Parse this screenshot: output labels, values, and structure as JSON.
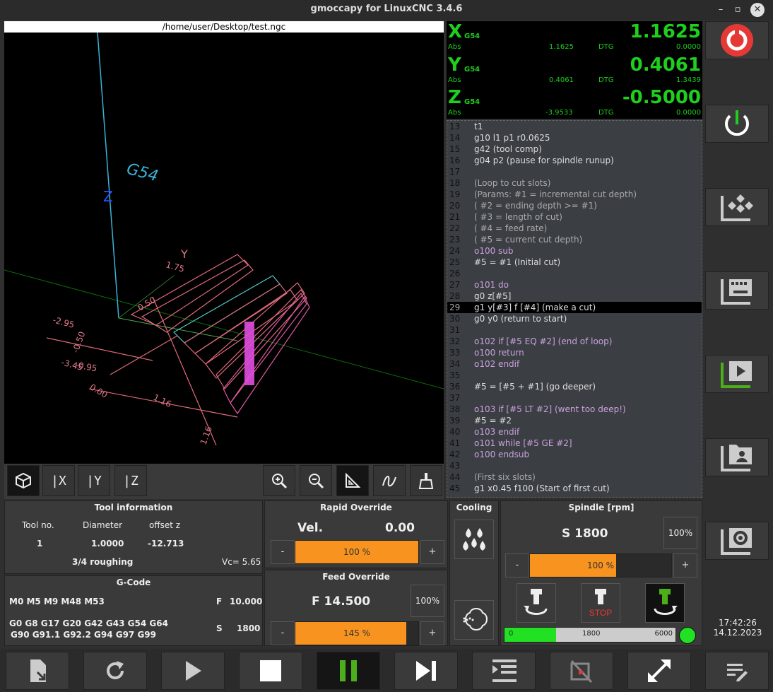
{
  "window": {
    "title": "gmoccapy for LinuxCNC  3.4.6"
  },
  "preview": {
    "filename": "/home/user/Desktop/test.ngc",
    "labels": {
      "coord": "G54",
      "zaxis": "Z",
      "yaxis": "Y",
      "d1": "-2.95",
      "d2": "-0.50",
      "d3": "-0.95",
      "d4": "-3.45",
      "d5": "0.00",
      "d6": "1.16",
      "d7": "1.16",
      "d8": "1.75",
      "d9": "0.50"
    }
  },
  "view_buttons": [
    "perspective-view",
    "x-view",
    "y-view",
    "z-view",
    "zoom-in",
    "zoom-out",
    "dimensions",
    "tool-path",
    "clear-plot"
  ],
  "dro": {
    "axes": [
      {
        "axis": "X",
        "cs": "G54",
        "value": "1.1625",
        "abs_label": "Abs",
        "abs": "1.1625",
        "dtg_label": "DTG",
        "dtg": "0.0000"
      },
      {
        "axis": "Y",
        "cs": "G54",
        "value": "0.4061",
        "abs_label": "Abs",
        "abs": "0.4061",
        "dtg_label": "DTG",
        "dtg": "1.3439"
      },
      {
        "axis": "Z",
        "cs": "G54",
        "value": "-0.5000",
        "abs_label": "Abs",
        "abs": "-3.9533",
        "dtg_label": "DTG",
        "dtg": "0.0000"
      }
    ]
  },
  "gcode_lines": [
    {
      "n": "13",
      "t": "t1"
    },
    {
      "n": "14",
      "t": "g10 l1 p1 r0.0625"
    },
    {
      "n": "15",
      "t": "g42 (tool comp)"
    },
    {
      "n": "16",
      "t": "g04 p2 (pause for spindle runup)"
    },
    {
      "n": "17",
      "t": ""
    },
    {
      "n": "18",
      "t": "(Loop to cut slots)"
    },
    {
      "n": "19",
      "t": "(Params: #1 = incremental cut depth)"
    },
    {
      "n": "20",
      "t": "( #2 = ending depth >= #1)"
    },
    {
      "n": "21",
      "t": "( #3 = length of cut)"
    },
    {
      "n": "22",
      "t": "( #4 = feed rate)"
    },
    {
      "n": "23",
      "t": "( #5 = current cut depth)"
    },
    {
      "n": "24",
      "t": "o100 sub"
    },
    {
      "n": "25",
      "t": "#5 = #1 (Initial cut)"
    },
    {
      "n": "26",
      "t": ""
    },
    {
      "n": "27",
      "t": "o101 do"
    },
    {
      "n": "28",
      "t": "g0 z[#5]"
    },
    {
      "n": "29",
      "t": "g1 y[#3] f [#4] (make a cut)"
    },
    {
      "n": "30",
      "t": "g0 y0 (return to start)"
    },
    {
      "n": "31",
      "t": ""
    },
    {
      "n": "32",
      "t": "o102 if [#5 EQ #2] (end of loop)"
    },
    {
      "n": "33",
      "t": "o100 return"
    },
    {
      "n": "34",
      "t": "o102 endif"
    },
    {
      "n": "35",
      "t": ""
    },
    {
      "n": "36",
      "t": "#5 = [#5 + #1] (go deeper)"
    },
    {
      "n": "37",
      "t": ""
    },
    {
      "n": "38",
      "t": "o103 if [#5 LT #2] (went too deep!)"
    },
    {
      "n": "39",
      "t": "#5 = #2"
    },
    {
      "n": "40",
      "t": "o103 endif"
    },
    {
      "n": "41",
      "t": "o101 while [#5 GE #2]"
    },
    {
      "n": "42",
      "t": "o100 endsub"
    },
    {
      "n": "43",
      "t": ""
    },
    {
      "n": "44",
      "t": "(First six slots)"
    },
    {
      "n": "45",
      "t": "g1 x0.45 f100 (Start of first cut)"
    }
  ],
  "current_line": "29",
  "tool_info": {
    "title": "Tool information",
    "h_no": "Tool no.",
    "h_dia": "Diameter",
    "h_off": "offset z",
    "no": "1",
    "dia": "1.0000",
    "off": "-12.713",
    "desc": "3/4 roughing",
    "vc": "Vc= 5.65"
  },
  "gcode": {
    "title": "G-Code",
    "mcodes": "M0 M5 M9 M48 M53",
    "f_label": "F",
    "f_val": "10.000",
    "gcodes1": "G0 G8 G17 G20 G42 G43 G54 G64",
    "gcodes2": "G90 G91.1 G92.2 G94 G97 G99",
    "s_label": "S",
    "s_val": "1800"
  },
  "rapid": {
    "title": "Rapid Override",
    "vel_label": "Vel.",
    "vel_val": "0.00",
    "pct": "100 %",
    "frac": 0.5,
    "minus": "-",
    "plus": "+"
  },
  "feed": {
    "title": "Feed Override",
    "value": "F 14.500",
    "reset": "100%",
    "pct": "145 %",
    "frac": 0.9,
    "minus": "-",
    "plus": "+"
  },
  "cooling": {
    "title": "Cooling"
  },
  "spindle": {
    "title": "Spindle [rpm]",
    "value": "S 1800",
    "reset": "100%",
    "pct": "100 %",
    "frac": 0.61,
    "minus": "-",
    "plus": "+",
    "stop_label": "STOP",
    "bar_min": "0",
    "bar_mid": "1800",
    "bar_max": "6000",
    "bar_frac": 0.3
  },
  "clock": {
    "time": "17:42:26",
    "date": "14.12.2023"
  },
  "colors": {
    "accent": "#f7931e",
    "dro": "#1ecf1e",
    "estop": "#e53935",
    "active": "#4caf1a"
  }
}
